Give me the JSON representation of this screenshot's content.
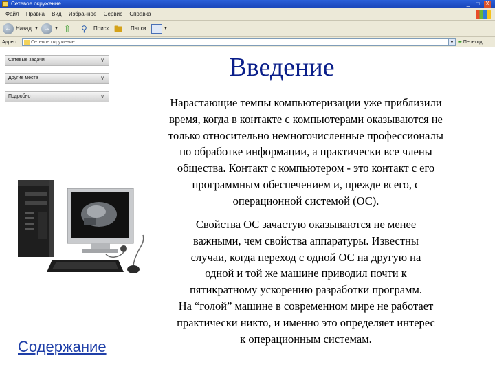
{
  "window": {
    "title": "Сетевое окружение",
    "buttons": [
      "_",
      "□",
      "X"
    ]
  },
  "menubar": {
    "items": [
      "Файл",
      "Правка",
      "Вид",
      "Избранное",
      "Сервис",
      "Справка"
    ]
  },
  "toolbar": {
    "back_label": "Назад",
    "search_label": "Поиск",
    "folders_label": "Папки"
  },
  "addressbar": {
    "label": "Адрес:",
    "value": "Сетевое окружение",
    "go_label": "Переход"
  },
  "taskpane": {
    "sections": [
      {
        "label": "Сетевые задачи"
      },
      {
        "label": "Другие места"
      },
      {
        "label": "Подробно"
      }
    ]
  },
  "slide": {
    "title": "Введение",
    "paragraph1": [
      "Нарастающие темпы компьютеризации уже приблизили",
      "время, когда в контакте с компьютерами оказываются не",
      "только относительно немногочисленные профессионалы",
      "по обработке информации, а практически все члены",
      "общества. Контакт с компьютером - это контакт с его",
      "программным обеспечением и, прежде всего, с",
      "операционной системой (ОС)."
    ],
    "paragraph2": [
      "Свойства ОС зачастую оказываются не менее",
      "важными, чем свойства аппаратуры. Известны",
      "случаи, когда переход с одной ОС на другую на",
      "одной и той же машине приводил почти к",
      "пятикратному ускорению разработки программ.",
      "На “голой” машине в современном мире не работает",
      "практически никто, и именно это определяет интерес",
      "к операционным системам."
    ],
    "contents_link": "Содержание"
  },
  "colors": {
    "title": "#0b1f8a",
    "link": "#1f3fa8",
    "chrome": "#ece9d8",
    "titlebar": "#1944b8"
  }
}
